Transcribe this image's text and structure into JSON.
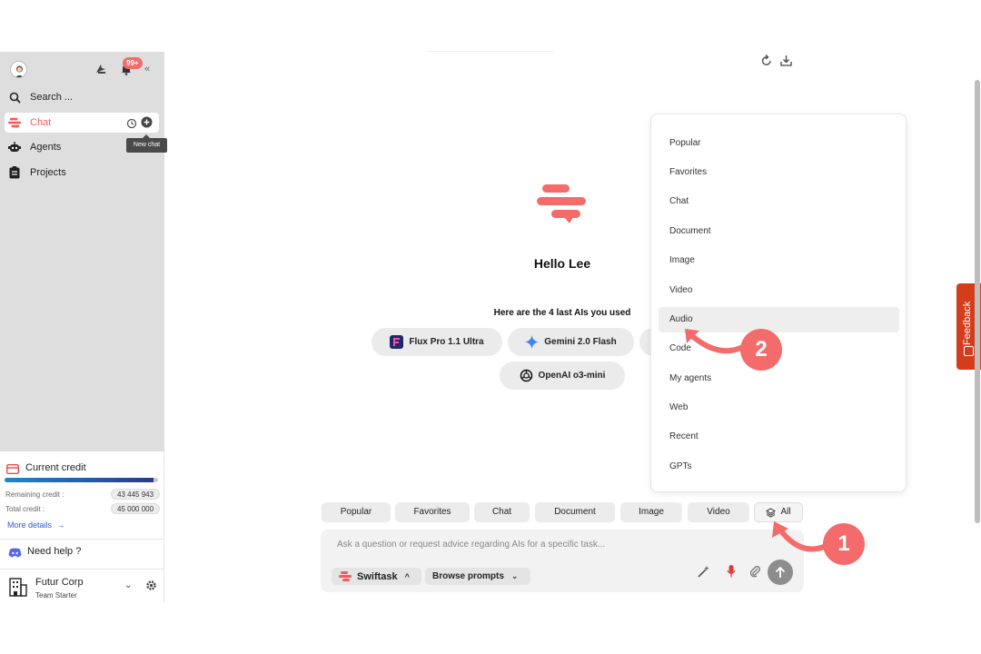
{
  "sidebar": {
    "notification_count": "99+",
    "search_label": "Search ...",
    "items": [
      {
        "label": "Chat"
      },
      {
        "label": "Agents"
      },
      {
        "label": "Projects"
      }
    ],
    "tooltip": "New chat",
    "credit": {
      "title": "Current credit",
      "progress": 0.97,
      "remaining_label": "Remaining credit :",
      "remaining_value": "43 445 943",
      "total_label": "Total credit :",
      "total_value": "45 000 000",
      "more_details": "More details"
    },
    "help": "Need help ?",
    "org": {
      "name": "Futur Corp",
      "plan": "Team Starter"
    }
  },
  "main": {
    "greeting": "Hello Lee",
    "recent_label": "Here are the 4 last AIs you used",
    "recent_ais": [
      {
        "name": "Flux Pro 1.1 Ultra",
        "icon": "flux-logo-icon"
      },
      {
        "name": "Gemini 2.0 Flash",
        "icon": "gemini-logo-icon"
      },
      {
        "name": "OpenAI o3-mini",
        "icon": "openai-logo-icon"
      }
    ]
  },
  "dropdown": {
    "items": [
      "Popular",
      "Favorites",
      "Chat",
      "Document",
      "Image",
      "Video",
      "Audio",
      "Code",
      "My agents",
      "Web",
      "Recent",
      "GPTs"
    ],
    "selected": "Audio"
  },
  "categories": [
    "Popular",
    "Favorites",
    "Chat",
    "Document",
    "Image",
    "Video",
    "All"
  ],
  "input": {
    "placeholder": "Ask a question or request advice regarding AIs for a specific task...",
    "model_chip": "Swiftask",
    "prompts_chip": "Browse prompts"
  },
  "annotations": {
    "step1": "1",
    "step2": "2"
  },
  "feedback_label": "Feedback",
  "colors": {
    "accent": "#f36b6b",
    "feedback": "#d43d1b"
  }
}
